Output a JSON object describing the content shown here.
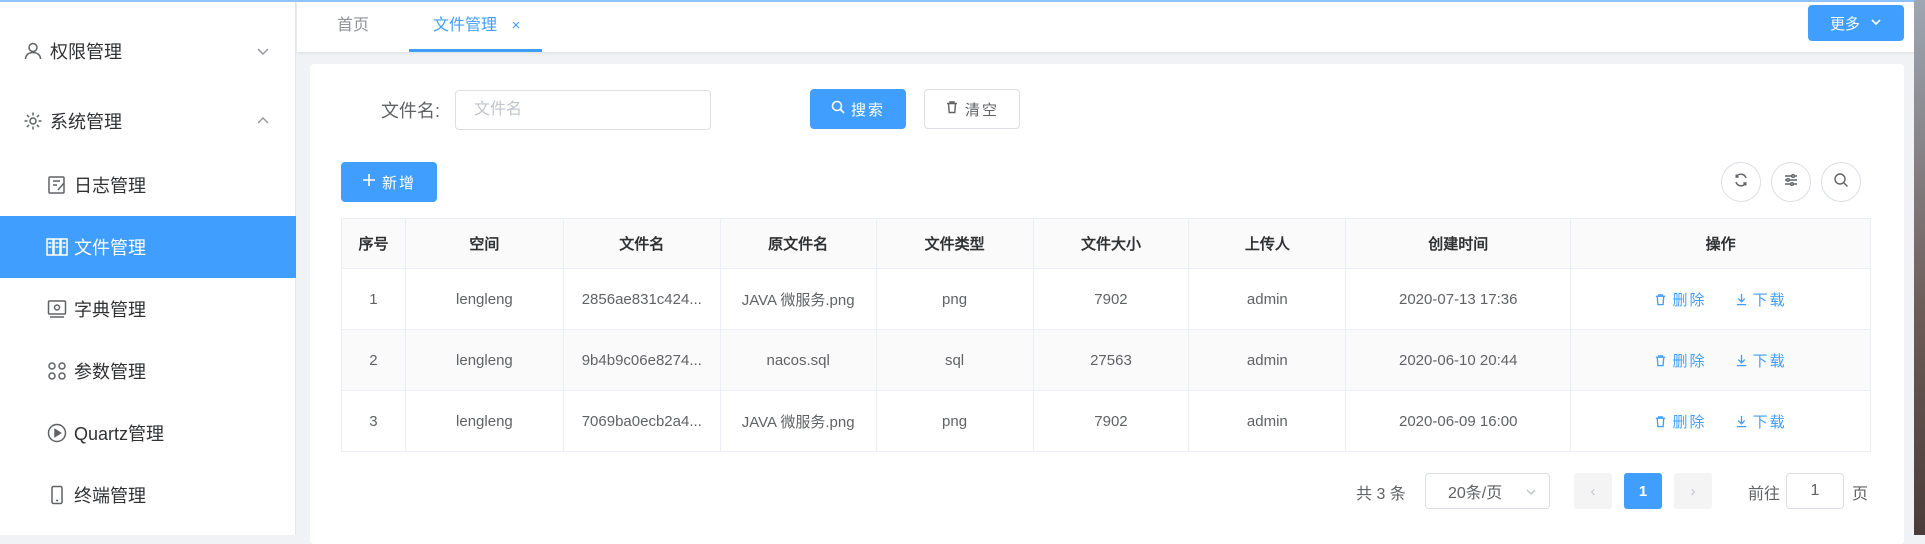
{
  "colors": {
    "primary": "#409eff",
    "text": "#606266",
    "border": "#dcdfe6"
  },
  "sidebar": {
    "items": [
      {
        "label": "权限管理",
        "icon": "user-icon",
        "level": 1,
        "expanded": false
      },
      {
        "label": "系统管理",
        "icon": "gear-icon",
        "level": 1,
        "expanded": true
      },
      {
        "label": "日志管理",
        "icon": "edit-icon",
        "level": 2
      },
      {
        "label": "文件管理",
        "icon": "files-icon",
        "level": 2,
        "active": true
      },
      {
        "label": "字典管理",
        "icon": "dictionary-icon",
        "level": 2
      },
      {
        "label": "参数管理",
        "icon": "command-icon",
        "level": 2
      },
      {
        "label": "Quartz管理",
        "icon": "play-circle-icon",
        "level": 2
      },
      {
        "label": "终端管理",
        "icon": "mobile-icon",
        "level": 2
      }
    ]
  },
  "tabs": [
    {
      "label": "首页",
      "active": false
    },
    {
      "label": "文件管理",
      "active": true,
      "closable": true,
      "close_glyph": "×"
    }
  ],
  "more_button": {
    "label": "更多"
  },
  "search": {
    "label": "文件名:",
    "placeholder": "文件名",
    "value": "",
    "search_label": "搜索",
    "clear_label": "清空"
  },
  "toolbar": {
    "add_label": "新增",
    "icons": [
      "refresh-icon",
      "filter-settings-icon",
      "search-icon"
    ]
  },
  "table": {
    "columns": [
      "序号",
      "空间",
      "文件名",
      "原文件名",
      "文件类型",
      "文件大小",
      "上传人",
      "创建时间",
      "操作"
    ],
    "rows": [
      {
        "index": "1",
        "space": "lengleng",
        "file_name": "2856ae831c424...",
        "original_name": "JAVA 微服务.png",
        "type": "png",
        "size": "7902",
        "uploader": "admin",
        "created": "2020-07-13 17:36"
      },
      {
        "index": "2",
        "space": "lengleng",
        "file_name": "9b4b9c06e8274...",
        "original_name": "nacos.sql",
        "type": "sql",
        "size": "27563",
        "uploader": "admin",
        "created": "2020-06-10 20:44"
      },
      {
        "index": "3",
        "space": "lengleng",
        "file_name": "7069ba0ecb2a4...",
        "original_name": "JAVA 微服务.png",
        "type": "png",
        "size": "7902",
        "uploader": "admin",
        "created": "2020-06-09 16:00"
      }
    ],
    "actions": {
      "delete_label": "删除",
      "download_label": "下载"
    }
  },
  "pagination": {
    "total_text": "共 3 条",
    "page_size": "20条/页",
    "prev_glyph": "‹",
    "next_glyph": "›",
    "current_page": "1",
    "goto_label": "前往",
    "goto_value": "1",
    "page_suffix": "页"
  }
}
